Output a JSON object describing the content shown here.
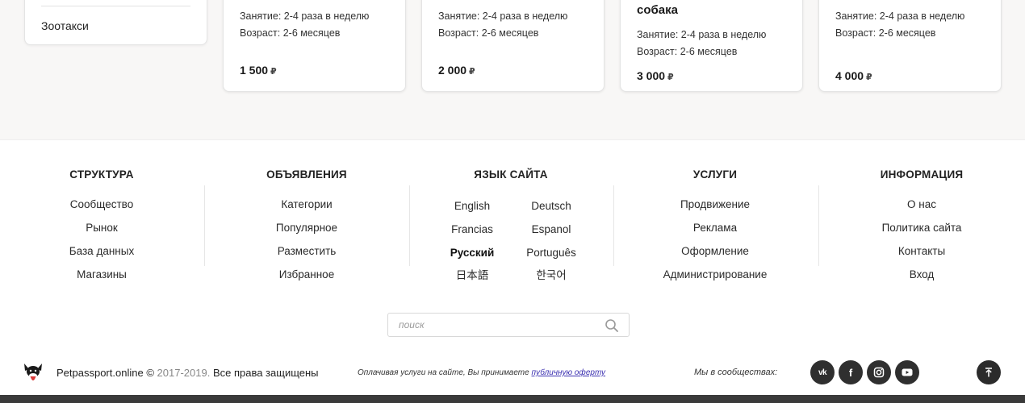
{
  "sidebar": {
    "items": [
      "Зоотакси"
    ]
  },
  "cards": [
    {
      "title_tail": "",
      "session": "Занятие: 2-4 раза в неделю",
      "age": "Возраст: 2-6 месяцев",
      "price": "1 500",
      "currency": "₽"
    },
    {
      "title_tail": "",
      "session": "Занятие: 2-4 раза в неделю",
      "age": "Возраст: 2-6 месяцев",
      "price": "2 000",
      "currency": "₽"
    },
    {
      "title_tail": "собака",
      "session": "Занятие: 2-4 раза в неделю",
      "age": "Возраст: 2-6 месяцев",
      "price": "3 000",
      "currency": "₽"
    },
    {
      "title_tail": "",
      "session": "Занятие: 2-4 раза в неделю",
      "age": "Возраст: 2-6 месяцев",
      "price": "4 000",
      "currency": "₽"
    }
  ],
  "footer": {
    "structure": {
      "heading": "СТРУКТУРА",
      "links": [
        "Сообщество",
        "Рынок",
        "База данных",
        "Магазины"
      ]
    },
    "ads": {
      "heading": "ОБЪЯВЛЕНИЯ",
      "links": [
        "Категории",
        "Популярное",
        "Разместить",
        "Избранное"
      ]
    },
    "language": {
      "heading": "ЯЗЫК САЙТА",
      "options": [
        "English",
        "Deutsch",
        "Francias",
        "Espanol",
        "Русский",
        "Português",
        "日本語",
        "한국어"
      ],
      "active": "Русский"
    },
    "services": {
      "heading": "УСЛУГИ",
      "links": [
        "Продвижение",
        "Реклама",
        "Оформление",
        "Администрирование"
      ]
    },
    "info": {
      "heading": "ИНФОРМАЦИЯ",
      "links": [
        "О нас",
        "Политика сайта",
        "Контакты",
        "Вход"
      ]
    }
  },
  "search": {
    "placeholder": "поиск",
    "value": ""
  },
  "bottom": {
    "brand": "Petpassport.online",
    "copyright_sign": "©",
    "years": "2017-2019.",
    "rights": "Все права защищены",
    "offer_text": "Оплачивая услуги на сайте, Вы принимаете",
    "offer_link": "публичную оферту",
    "community_label": "Мы в сообществах:",
    "socials": [
      {
        "name": "vk-icon",
        "glyph": "vk"
      },
      {
        "name": "facebook-icon",
        "glyph": "f"
      },
      {
        "name": "instagram-icon",
        "glyph": ""
      },
      {
        "name": "youtube-icon",
        "glyph": ""
      }
    ]
  },
  "colors": {
    "background_top": "#f8f7f6",
    "social_bg": "#2f2f2f",
    "link_accent": "#3a2fb0",
    "bottom_bar": "#3a3a3a"
  }
}
